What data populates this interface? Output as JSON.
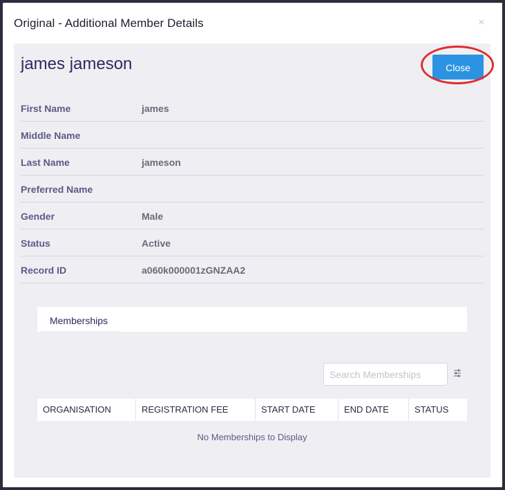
{
  "modal": {
    "title": "Original - Additional Member Details",
    "close_glyph": "×"
  },
  "member": {
    "full_name": "james jameson",
    "close_label": "Close"
  },
  "fields": [
    {
      "label": "First Name",
      "value": "james"
    },
    {
      "label": "Middle Name",
      "value": ""
    },
    {
      "label": "Last Name",
      "value": "jameson"
    },
    {
      "label": "Preferred Name",
      "value": ""
    },
    {
      "label": "Gender",
      "value": "Male"
    },
    {
      "label": "Status",
      "value": "Active"
    },
    {
      "label": "Record ID",
      "value": "a060k000001zGNZAA2"
    }
  ],
  "tabs": [
    {
      "label": "Memberships"
    }
  ],
  "memberships": {
    "search_placeholder": "Search Memberships",
    "columns": [
      "ORGANISATION",
      "REGISTRATION FEE",
      "START DATE",
      "END DATE",
      "STATUS"
    ],
    "empty_message": "No Memberships to Display"
  },
  "icons": {
    "filter": "sliders-icon",
    "close": "close-icon"
  },
  "colors": {
    "accent": "#2b93e2",
    "highlight_ring": "#e02d2d",
    "panel_bg": "#efeff3",
    "heading_text": "#2b2a5e"
  }
}
